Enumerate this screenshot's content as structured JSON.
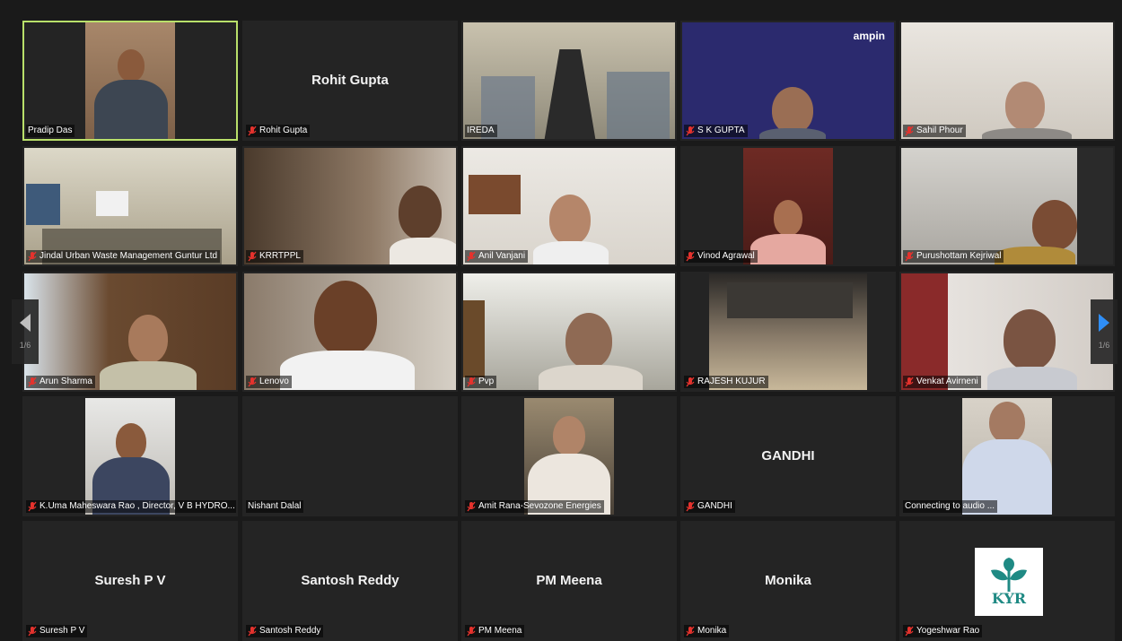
{
  "meeting": {
    "page_indicator_left": "1/6",
    "page_indicator_right": "1/6",
    "colors": {
      "active_speaker_border": "#b9e06a",
      "mute_icon": "#e5322d",
      "nav_arrow_right": "#2f8ef7",
      "nav_arrow_left": "#bfbfbf"
    }
  },
  "participants": [
    {
      "label": "Pradip Das",
      "tile_name": "",
      "muted": false,
      "video": true,
      "active": true
    },
    {
      "label": "Rohit Gupta",
      "tile_name": "Rohit Gupta",
      "muted": true,
      "video": false,
      "active": false
    },
    {
      "label": "IREDA",
      "tile_name": "",
      "muted": false,
      "video": true,
      "active": false
    },
    {
      "label": "S K GUPTA",
      "tile_name": "",
      "muted": true,
      "video": true,
      "active": false,
      "backdrop_text": "ampin"
    },
    {
      "label": "Sahil Phour",
      "tile_name": "",
      "muted": true,
      "video": true,
      "active": false
    },
    {
      "label": "Jindal Urban Waste Management Guntur Ltd",
      "tile_name": "",
      "muted": true,
      "video": true,
      "active": false
    },
    {
      "label": "KRRTPPL",
      "tile_name": "",
      "muted": true,
      "video": true,
      "active": false
    },
    {
      "label": "Anil Vanjani",
      "tile_name": "",
      "muted": true,
      "video": true,
      "active": false
    },
    {
      "label": "Vinod Agrawal",
      "tile_name": "",
      "muted": true,
      "video": true,
      "active": false
    },
    {
      "label": "Purushottam Kejriwal",
      "tile_name": "",
      "muted": true,
      "video": true,
      "active": false
    },
    {
      "label": "Arun Sharma",
      "tile_name": "",
      "muted": true,
      "video": true,
      "active": false
    },
    {
      "label": "Lenovo",
      "tile_name": "",
      "muted": true,
      "video": true,
      "active": false
    },
    {
      "label": "Pvp",
      "tile_name": "",
      "muted": true,
      "video": true,
      "active": false
    },
    {
      "label": "RAJESH KUJUR",
      "tile_name": "",
      "muted": true,
      "video": true,
      "active": false
    },
    {
      "label": "Venkat Avirneni",
      "tile_name": "",
      "muted": true,
      "video": true,
      "active": false
    },
    {
      "label": "K.Uma Maheswara Rao , Director, V B HYDRO...",
      "tile_name": "",
      "muted": true,
      "video": true,
      "active": false
    },
    {
      "label": "Nishant Dalal",
      "tile_name": "",
      "muted": false,
      "video": false,
      "active": false
    },
    {
      "label": "Amit Rana-Sevozone Energies",
      "tile_name": "",
      "muted": true,
      "video": true,
      "active": false
    },
    {
      "label": "GANDHI",
      "tile_name": "GANDHI",
      "muted": true,
      "video": false,
      "active": false
    },
    {
      "label": "Connecting to audio ...",
      "tile_name": "",
      "muted": false,
      "video": true,
      "active": false
    },
    {
      "label": "Suresh P V",
      "tile_name": "Suresh P V",
      "muted": true,
      "video": false,
      "active": false
    },
    {
      "label": "Santosh Reddy",
      "tile_name": "Santosh Reddy",
      "muted": true,
      "video": false,
      "active": false
    },
    {
      "label": "PM Meena",
      "tile_name": "PM Meena",
      "muted": true,
      "video": false,
      "active": false
    },
    {
      "label": "Monika",
      "tile_name": "Monika",
      "muted": true,
      "video": false,
      "active": false
    },
    {
      "label": "Yogeshwar Rao",
      "tile_name": "",
      "muted": true,
      "video": false,
      "active": false,
      "logo_text": "KYR"
    }
  ]
}
